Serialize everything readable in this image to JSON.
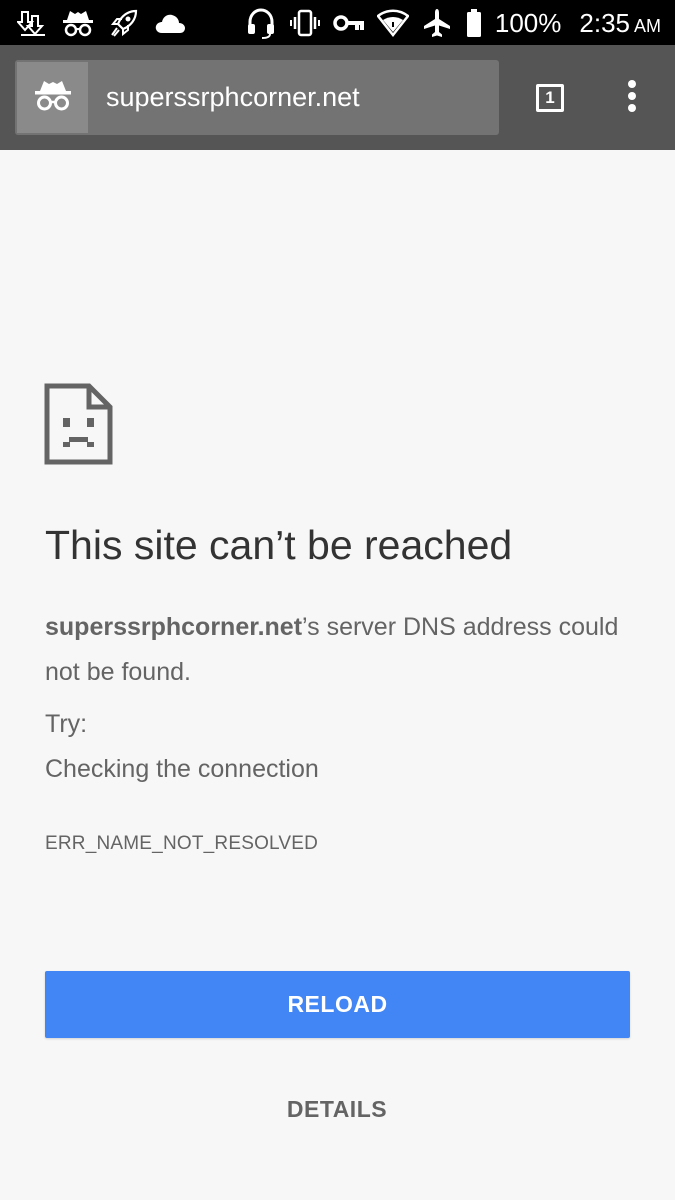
{
  "status_bar": {
    "left_icons": [
      "download-icon",
      "incognito-icon",
      "rocket-icon",
      "cloud-icon"
    ],
    "right_icons": [
      "headset-icon",
      "vibrate-icon",
      "vpn-key-icon",
      "wifi-icon",
      "airplane-icon",
      "battery-icon"
    ],
    "battery_percent": "100%",
    "time": "2:35",
    "ampm": "AM"
  },
  "toolbar": {
    "url": "superssrphcorner.net",
    "tab_count": "1",
    "incognito_icon": "incognito-icon",
    "menu_icon": "more-vert-icon"
  },
  "error_page": {
    "icon": "sad-page-icon",
    "title": "This site can’t be reached",
    "host": "superssrphcorner.net",
    "description_rest": "’s server DNS address could not be found.",
    "try_label": "Try:",
    "suggestions": [
      "Checking the connection"
    ],
    "error_code": "ERR_NAME_NOT_RESOLVED",
    "reload_label": "RELOAD",
    "details_label": "DETAILS"
  },
  "colors": {
    "status_bar_bg": "#000000",
    "toolbar_bg": "#555555",
    "omnibox_bg": "#737373",
    "page_bg": "#f7f7f7",
    "accent_blue": "#4285f4",
    "title_text": "#333333",
    "body_text": "#646464"
  }
}
